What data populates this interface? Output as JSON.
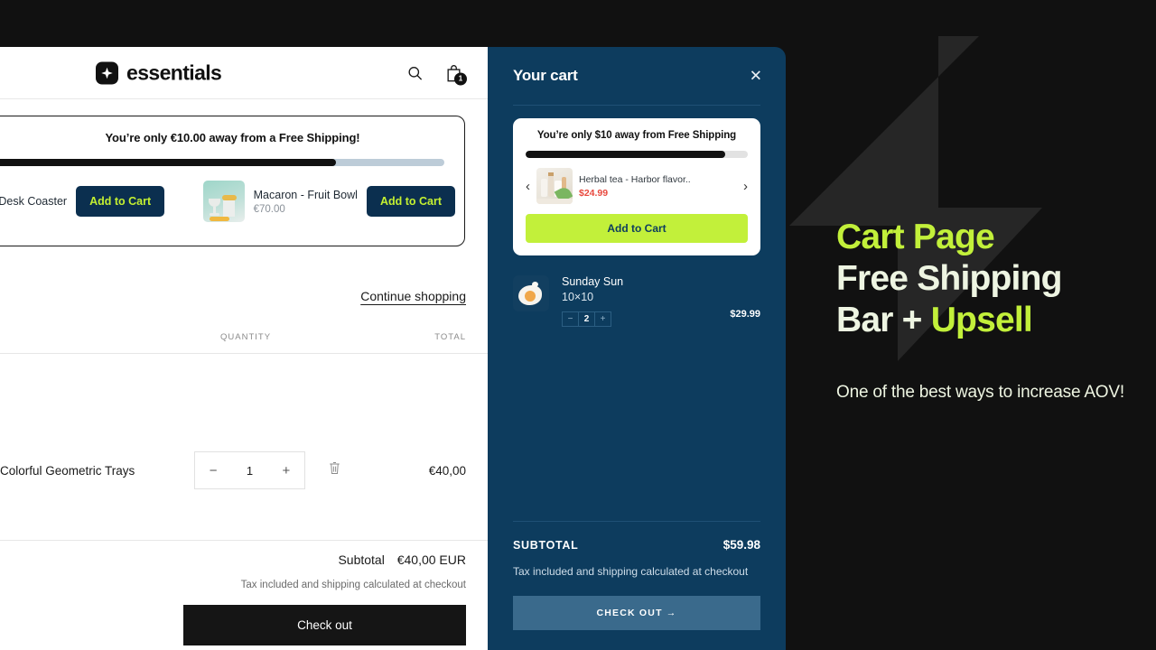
{
  "store": {
    "logo_text": "essentials",
    "logo_icon": "star-diamond-icon",
    "search_icon": "search-icon",
    "cart_icon": "shopping-bag-icon",
    "cart_count": "1",
    "upsell": {
      "title": "You’re only €10.00 away from a Free Shipping!",
      "progress_percent": 76,
      "items": [
        {
          "name": "ed Desk Coaster",
          "price": "",
          "button": "Add to Cart"
        },
        {
          "name": "Macaron - Fruit Bowl",
          "price": "€70.00",
          "button": "Add to Cart"
        }
      ]
    },
    "continue_shopping": "Continue shopping",
    "table_headers": {
      "quantity": "QUANTITY",
      "total": "TOTAL"
    },
    "line_items": [
      {
        "name": "Colorful Geometric Trays",
        "qty_minus": "−",
        "qty": "1",
        "qty_plus": "+",
        "remove_icon": "trash-icon",
        "total": "€40,00"
      }
    ],
    "subtotal_label": "Subtotal",
    "subtotal_value": "€40,00 EUR",
    "tax_note": "Tax included and shipping calculated at checkout",
    "checkout_button": "Check out"
  },
  "drawer": {
    "title": "Your cart",
    "close_icon": "close-icon",
    "upsell": {
      "title": "You’re only $10 away from Free Shipping",
      "progress_percent": 90,
      "prev_icon": "chevron-left-icon",
      "next_icon": "chevron-right-icon",
      "product_name": "Herbal tea - Harbor flavor..",
      "product_price": "$24.99",
      "button": "Add to Cart"
    },
    "line_items": [
      {
        "name": "Sunday Sun",
        "variant": "10×10",
        "qty_minus": "−",
        "qty": "2",
        "qty_plus": "+",
        "price": "$29.99"
      }
    ],
    "subtotal_label": "SUBTOTAL",
    "subtotal_value": "$59.98",
    "tax_note": "Tax included and shipping calculated at checkout",
    "checkout_button": "CHECK OUT →"
  },
  "promo": {
    "heading_line1": "Cart Page",
    "heading_line2": "Free Shipping",
    "heading_line3a": "Bar + ",
    "heading_line3b": "Upsell",
    "subtext": "One of the best ways to increase AOV!",
    "background_icon": "lightning-bolt-watermark"
  },
  "colors": {
    "promo_bg": "#111111",
    "drawer_bg": "#0d3c5e",
    "accent_lime": "#c2f03a",
    "navy_button": "#0b2f4f",
    "price_red": "#e8483d",
    "checkout_dark": "#151515"
  }
}
